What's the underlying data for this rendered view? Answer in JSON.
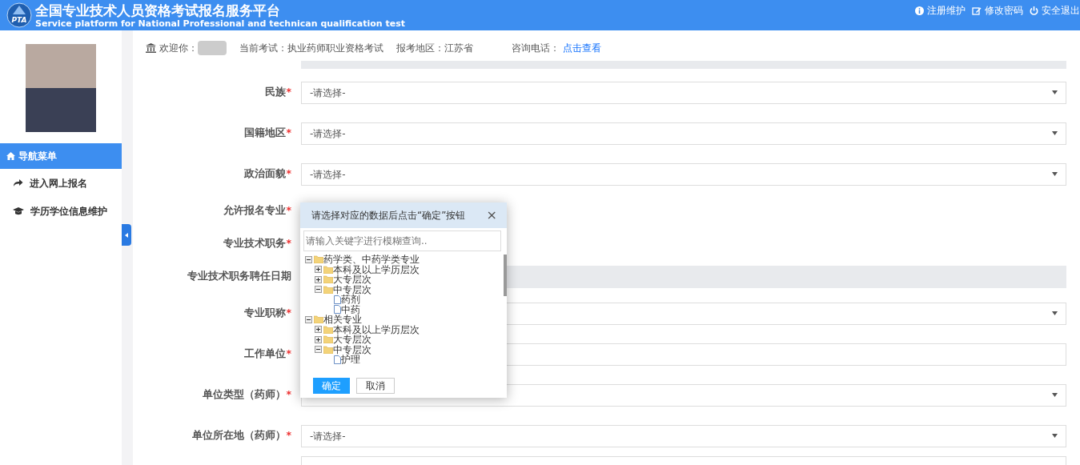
{
  "header": {
    "title": "全国专业技术人员资格考试报名服务平台",
    "subtitle": "Service platform for National Professional and technican qualification test",
    "logo_text": "PTA",
    "links": [
      {
        "kind": "info",
        "label": "注册维护"
      },
      {
        "kind": "edit",
        "label": "修改密码"
      },
      {
        "kind": "power",
        "label": "安全退出"
      }
    ]
  },
  "sidebar": {
    "menu_title": "导航菜单",
    "items": [
      {
        "kind": "share",
        "label": "进入网上报名"
      },
      {
        "kind": "cap",
        "label": "学历学位信息维护"
      }
    ]
  },
  "info_bar": {
    "welcome": "欢迎你：",
    "exam": "当前考试：执业药师职业资格考试",
    "region": "报考地区：江苏省",
    "phone_label": "咨询电话：",
    "phone_link": "点击查看"
  },
  "form": [
    {
      "label": "民族",
      "required_mark": "*",
      "kind": "select",
      "value": "-请选择-"
    },
    {
      "label": "国籍地区",
      "required_mark": "*",
      "kind": "select",
      "value": "-请选择-"
    },
    {
      "label": "政治面貌",
      "required_mark": "*",
      "kind": "select",
      "value": "-请选择-"
    },
    {
      "label": "允许报名专业",
      "required_mark": "*",
      "kind": "none"
    },
    {
      "label": "专业技术职务",
      "required_mark": "*",
      "kind": "none"
    },
    {
      "label": "专业技术职务聘任日期",
      "kind": "readonly"
    },
    {
      "label": "专业职称",
      "required_mark": "*",
      "kind": "select"
    },
    {
      "label": "工作单位",
      "required_mark": "*",
      "kind": "text"
    },
    {
      "label": "单位类型（药师）",
      "required_mark": "*",
      "kind": "select"
    },
    {
      "label": "单位所在地（药师）",
      "required_mark": "*",
      "kind": "select",
      "value": "-请选择-"
    }
  ],
  "dialog": {
    "title": "请选择对应的数据后点击“确定”按钮",
    "close": "×",
    "search_placeholder": "请输入关键字进行模糊查询..",
    "tree": [
      {
        "kind": "folder",
        "label": "药学类、中药学类专业",
        "expanded": true,
        "children": [
          {
            "kind": "folder",
            "label": "本科及以上学历层次",
            "expanded": false
          },
          {
            "kind": "folder",
            "label": "大专层次",
            "expanded": false
          },
          {
            "kind": "folder",
            "label": "中专层次",
            "expanded": true,
            "children": [
              {
                "kind": "file",
                "label": "药剂"
              },
              {
                "kind": "file",
                "label": "中药"
              }
            ]
          }
        ]
      },
      {
        "kind": "folder",
        "label": "相关专业",
        "expanded": true,
        "children": [
          {
            "kind": "folder",
            "label": "本科及以上学历层次",
            "expanded": false
          },
          {
            "kind": "folder",
            "label": "大专层次",
            "expanded": false
          },
          {
            "kind": "folder",
            "label": "中专层次",
            "expanded": true,
            "children": [
              {
                "kind": "file",
                "label": "护理"
              }
            ]
          }
        ]
      }
    ],
    "buttons": [
      {
        "kind": "primary",
        "label": "确定"
      },
      {
        "kind": "secondary",
        "label": "取消"
      }
    ]
  }
}
